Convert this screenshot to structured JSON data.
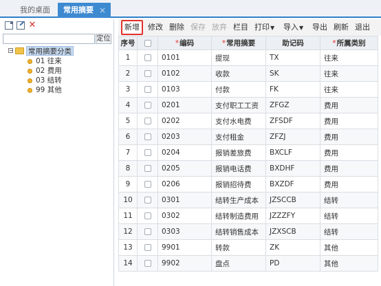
{
  "tabs": [
    {
      "label": "我的桌面"
    },
    {
      "label": "常用摘要",
      "active": true,
      "close": "×"
    }
  ],
  "left_panel": {
    "locate_label": "定位",
    "search_value": "",
    "tree": {
      "root": "常用摘要分类",
      "expander": "−",
      "children": [
        "01 往来",
        "02 费用",
        "03 结转",
        "99 其他"
      ]
    }
  },
  "toolbar": {
    "add": "新增",
    "edit": "修改",
    "delete": "删除",
    "save": "保存",
    "discard": "放弃",
    "columns": "栏目",
    "print": "打印",
    "import": "导入",
    "export": "导出",
    "refresh": "刷新",
    "exit": "退出"
  },
  "table": {
    "required_mark": "*",
    "headers": {
      "no": "序号",
      "code": "编码",
      "summary": "常用摘要",
      "mnemonic": "助记码",
      "category": "所属类别"
    },
    "rows": [
      {
        "no": "1",
        "code": "0101",
        "summary": "提现",
        "mnemonic": "TX",
        "category": "往来"
      },
      {
        "no": "2",
        "code": "0102",
        "summary": "收款",
        "mnemonic": "SK",
        "category": "往来"
      },
      {
        "no": "3",
        "code": "0103",
        "summary": "付款",
        "mnemonic": "FK",
        "category": "往来"
      },
      {
        "no": "4",
        "code": "0201",
        "summary": "支付职工工资",
        "mnemonic": "ZFGZ",
        "category": "费用"
      },
      {
        "no": "5",
        "code": "0202",
        "summary": "支付水电费",
        "mnemonic": "ZFSDF",
        "category": "费用"
      },
      {
        "no": "6",
        "code": "0203",
        "summary": "支付租金",
        "mnemonic": "ZFZJ",
        "category": "费用"
      },
      {
        "no": "7",
        "code": "0204",
        "summary": "报销差旅费",
        "mnemonic": "BXCLF",
        "category": "费用"
      },
      {
        "no": "8",
        "code": "0205",
        "summary": "报销电话费",
        "mnemonic": "BXDHF",
        "category": "费用"
      },
      {
        "no": "9",
        "code": "0206",
        "summary": "报销招待费",
        "mnemonic": "BXZDF",
        "category": "费用"
      },
      {
        "no": "10",
        "code": "0301",
        "summary": "结转生产成本",
        "mnemonic": "JZSCCB",
        "category": "结转"
      },
      {
        "no": "11",
        "code": "0302",
        "summary": "结转制造费用",
        "mnemonic": "JZZZFY",
        "category": "结转"
      },
      {
        "no": "12",
        "code": "0303",
        "summary": "结转销售成本",
        "mnemonic": "JZXSCB",
        "category": "结转"
      },
      {
        "no": "13",
        "code": "9901",
        "summary": "转款",
        "mnemonic": "ZK",
        "category": "其他"
      },
      {
        "no": "14",
        "code": "9902",
        "summary": "盘点",
        "mnemonic": "PD",
        "category": "其他"
      }
    ]
  },
  "colors": {
    "accent": "#3d8ad1",
    "highlight_border": "#e3302b",
    "required": "#e3302b"
  },
  "icons": {
    "caret": "chevron-down-icon",
    "tree_folder": "folder-icon",
    "tree_leaf": "dot-icon"
  }
}
